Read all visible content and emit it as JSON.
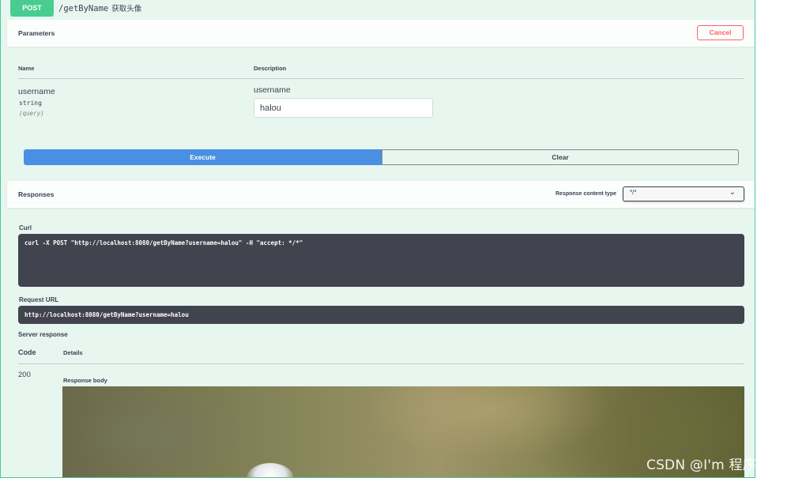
{
  "operation": {
    "method": "POST",
    "path": "/getByName",
    "summary": "获取头像"
  },
  "parameters": {
    "title": "Parameters",
    "cancel_label": "Cancel",
    "columns": {
      "name": "Name",
      "description": "Description"
    },
    "items": [
      {
        "name": "username",
        "type": "string",
        "in": "(query)",
        "description": "username",
        "value": "halou"
      }
    ]
  },
  "actions": {
    "execute_label": "Execute",
    "clear_label": "Clear"
  },
  "responses": {
    "title": "Responses",
    "content_type_label": "Response content type",
    "content_type_value": "*/*"
  },
  "curl": {
    "label": "Curl",
    "command": "curl -X POST \"http://localhost:8080/getByName?username=halou\" -H \"accept: */*\""
  },
  "request_url": {
    "label": "Request URL",
    "value": "http://localhost:8080/getByName?username=halou"
  },
  "server_response": {
    "label": "Server response",
    "code_header": "Code",
    "details_header": "Details",
    "code": "200",
    "body_label": "Response body"
  },
  "watermark": "CSDN @I'm 程序员",
  "colors": {
    "post_green": "#49cc90",
    "execute_blue": "#4990e2",
    "cancel_red": "#ff6060",
    "code_bg": "#41444e"
  }
}
